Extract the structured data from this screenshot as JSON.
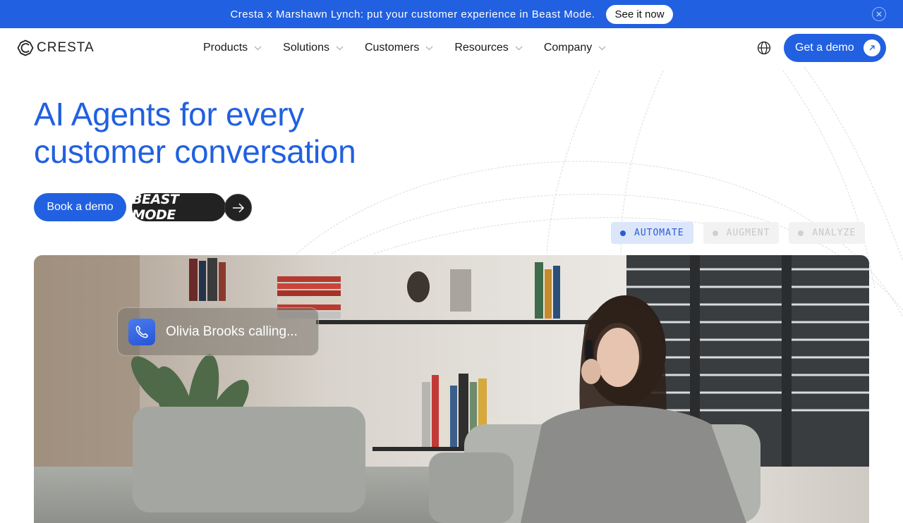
{
  "announcement": {
    "text": "Cresta x Marshawn Lynch: put your customer experience in Beast Mode.",
    "cta_label": "See it now",
    "close_icon": "close-circle-icon",
    "background": "#2160e0"
  },
  "header": {
    "logo_text": "CRESTA",
    "nav": [
      {
        "label": "Products"
      },
      {
        "label": "Solutions"
      },
      {
        "label": "Customers"
      },
      {
        "label": "Resources"
      },
      {
        "label": "Company"
      }
    ],
    "language_icon": "globe-icon",
    "cta_label": "Get a demo"
  },
  "hero": {
    "title_line1": "AI Agents for every",
    "title_line2": "customer conversation",
    "primary_cta": "Book a demo",
    "beast_label": "BEAST MODE",
    "accent": "#2160e0"
  },
  "tabs": [
    {
      "label": "AUTOMATE",
      "active": true
    },
    {
      "label": "AUGMENT",
      "active": false
    },
    {
      "label": "ANALYZE",
      "active": false
    }
  ],
  "media": {
    "call_card_text": "Olivia Brooks calling...",
    "call_icon": "phone-icon"
  }
}
